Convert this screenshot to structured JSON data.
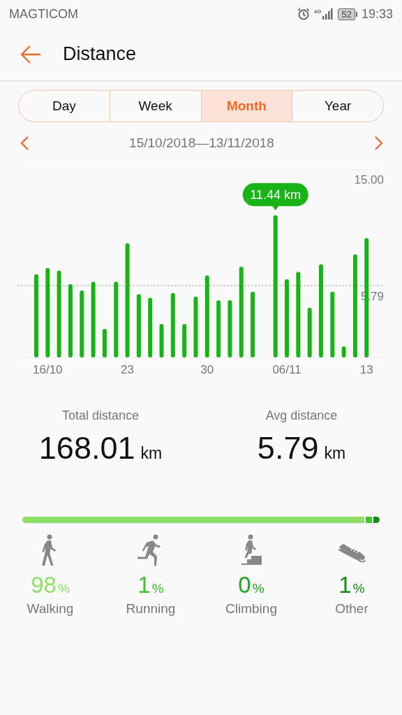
{
  "status_bar": {
    "carrier": "MAGTICOM",
    "network": "4G",
    "battery": "52",
    "time": "19:33"
  },
  "header": {
    "title": "Distance"
  },
  "tabs": [
    {
      "label": "Day",
      "selected": false
    },
    {
      "label": "Week",
      "selected": false
    },
    {
      "label": "Month",
      "selected": true
    },
    {
      "label": "Year",
      "selected": false
    }
  ],
  "date_range": "15/10/2018—13/11/2018",
  "chart": {
    "max_label": "15.00",
    "average_label": "5.79",
    "tooltip": "11.44 km",
    "x_labels": [
      "16/10",
      "23",
      "30",
      "06/11",
      "13"
    ]
  },
  "stats": [
    {
      "label": "Total distance",
      "value": "168.01",
      "unit": "km"
    },
    {
      "label": "Avg distance",
      "value": "5.79",
      "unit": "km"
    }
  ],
  "breakdown": [
    {
      "kind": "walking",
      "percent": "98",
      "unit": "%",
      "label": "Walking",
      "color": "#8ddf66"
    },
    {
      "kind": "running",
      "percent": "1",
      "unit": "%",
      "label": "Running",
      "color": "#3fc22a"
    },
    {
      "kind": "climbing",
      "percent": "0",
      "unit": "%",
      "label": "Climbing",
      "color": "#1ba81b"
    },
    {
      "kind": "other",
      "percent": "1",
      "unit": "%",
      "label": "Other",
      "color": "#138f13"
    }
  ]
}
